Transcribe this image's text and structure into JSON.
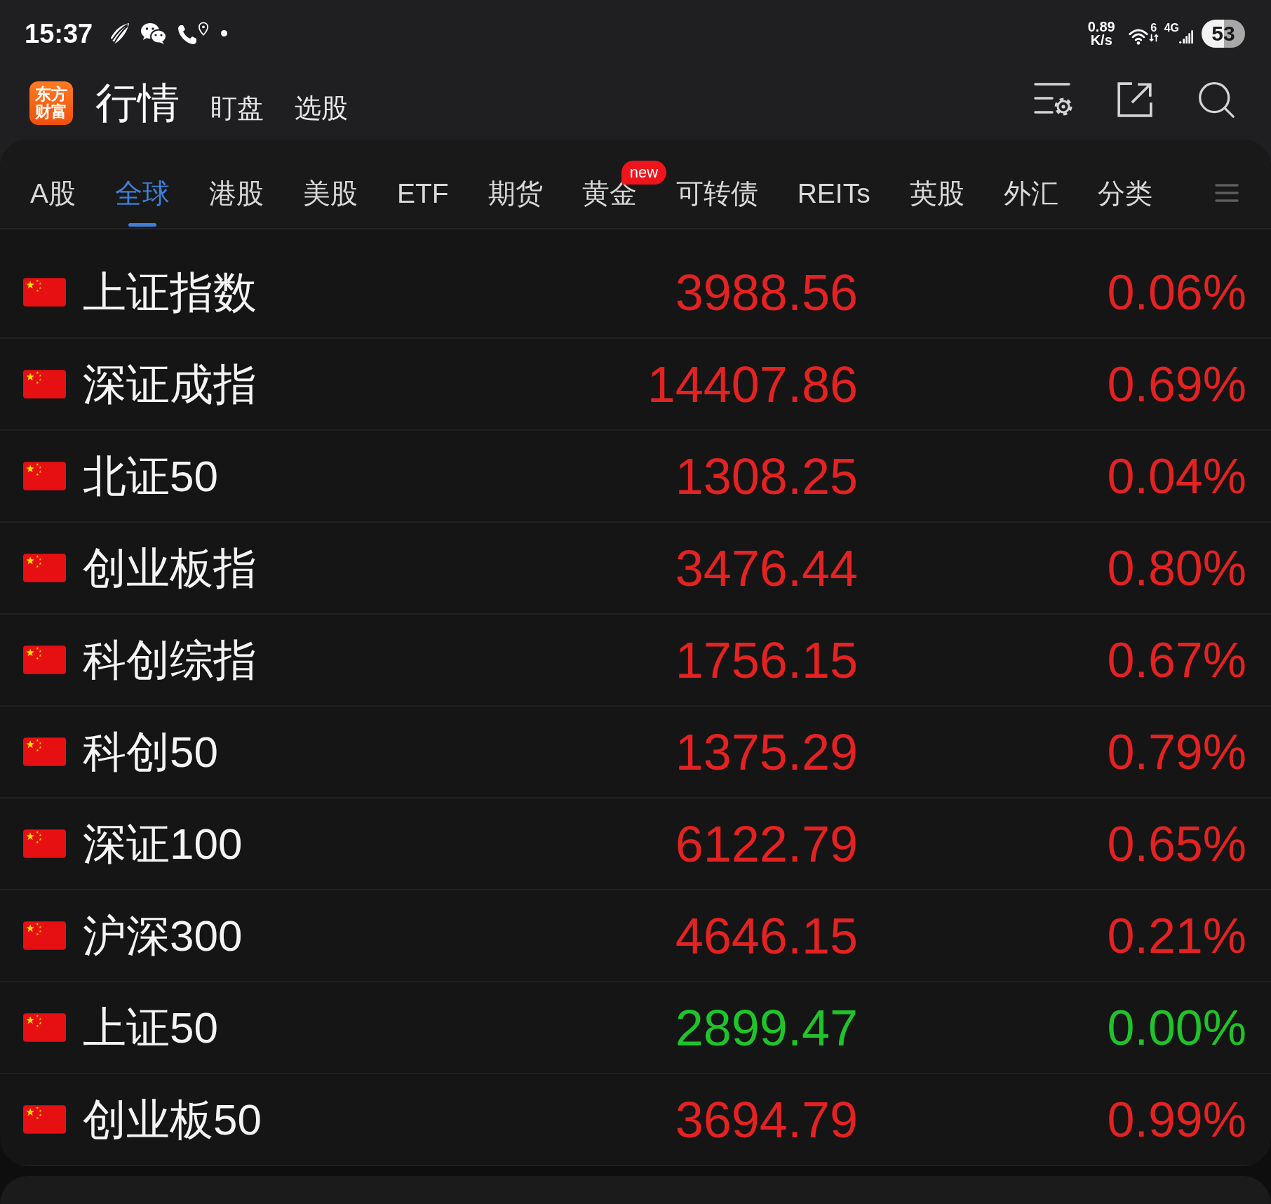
{
  "status_bar": {
    "time": "15:37",
    "net_speed": "0.89",
    "net_speed_unit": "K/s",
    "wifi_standard": "6",
    "network_type": "4G",
    "battery": "53"
  },
  "header": {
    "logo_lines": [
      "东方",
      "财富"
    ],
    "tabs": [
      {
        "label": "行情",
        "selected": true
      },
      {
        "label": "盯盘",
        "selected": false
      },
      {
        "label": "选股",
        "selected": false
      }
    ]
  },
  "market_tabs": [
    {
      "label": "A股",
      "selected": false
    },
    {
      "label": "全球",
      "selected": true
    },
    {
      "label": "港股",
      "selected": false
    },
    {
      "label": "美股",
      "selected": false
    },
    {
      "label": "ETF",
      "selected": false
    },
    {
      "label": "期货",
      "selected": false
    },
    {
      "label": "黄金",
      "selected": false,
      "badge": "new"
    },
    {
      "label": "可转债",
      "selected": false
    },
    {
      "label": "REITs",
      "selected": false
    },
    {
      "label": "英股",
      "selected": false
    },
    {
      "label": "外汇",
      "selected": false
    },
    {
      "label": "分类",
      "selected": false
    }
  ],
  "rows": [
    {
      "name": "上证指数",
      "price": "3988.56",
      "change": "0.06%",
      "color": "#e42222"
    },
    {
      "name": "深证成指",
      "price": "14407.86",
      "change": "0.69%",
      "color": "#e42222"
    },
    {
      "name": "北证50",
      "price": "1308.25",
      "change": "0.04%",
      "color": "#e42222"
    },
    {
      "name": "创业板指",
      "price": "3476.44",
      "change": "0.80%",
      "color": "#e42222"
    },
    {
      "name": "科创综指",
      "price": "1756.15",
      "change": "0.67%",
      "color": "#e42222"
    },
    {
      "name": "科创50",
      "price": "1375.29",
      "change": "0.79%",
      "color": "#e42222"
    },
    {
      "name": "深证100",
      "price": "6122.79",
      "change": "0.65%",
      "color": "#e42222"
    },
    {
      "name": "沪深300",
      "price": "4646.15",
      "change": "0.21%",
      "color": "#e42222"
    },
    {
      "name": "上证50",
      "price": "2899.47",
      "change": "0.00%",
      "color": "#1fc42a"
    },
    {
      "name": "创业板50",
      "price": "3694.79",
      "change": "0.99%",
      "color": "#e42222"
    }
  ]
}
